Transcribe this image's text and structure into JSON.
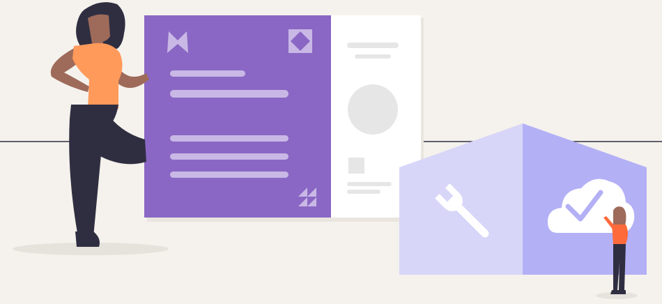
{
  "illustration": {
    "colors": {
      "background": "#f5f2ed",
      "horizon_line": "#2f2e41",
      "card_primary": "#8a67c4",
      "card_secondary": "#ffffff",
      "placeholder_light": "#c9b8e6",
      "placeholder_gray": "#e6e6e6",
      "box_left_face": "#d8d6f8",
      "box_right_face": "#b3b0f6",
      "shirt_orange": "#ff9a5a",
      "pants_dark": "#2f2e41",
      "skin": "#9e6a5a",
      "hair": "#2f2e41",
      "shadow": "#e6e2dc"
    },
    "icons": [
      "logo-bowtie-icon",
      "diamond-frame-icon",
      "triangles-icon",
      "wrench-icon",
      "cloud-check-icon"
    ]
  }
}
